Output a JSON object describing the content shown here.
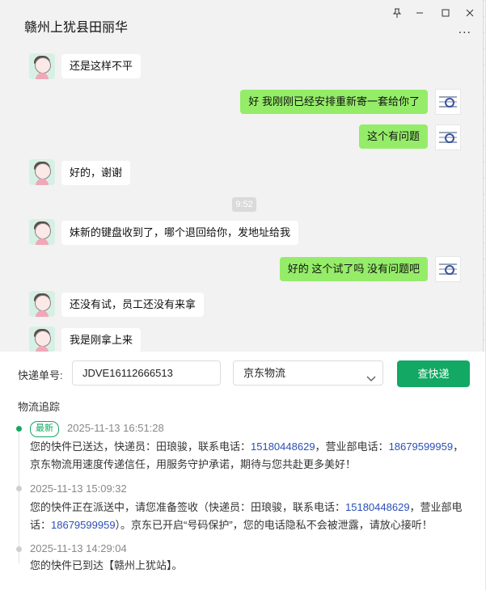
{
  "window": {
    "title": "赣州上犹县田丽华",
    "pin_icon": "pin-icon",
    "minimize_icon": "minimize-icon",
    "maximize_icon": "maximize-icon",
    "close_icon": "close-icon",
    "more_icon": "more-icon",
    "more_glyph": "..."
  },
  "messages": [
    {
      "side": "in",
      "text": "还是这样不平"
    },
    {
      "side": "out",
      "text": "好 我刚刚已经安排重新寄一套给你了"
    },
    {
      "side": "out",
      "text": "这个有问题"
    },
    {
      "side": "in",
      "text": "好的，谢谢"
    },
    {
      "side": "time",
      "text": "9:52"
    },
    {
      "side": "in",
      "text": "妹新的键盘收到了，哪个退回给你，发地址给我"
    },
    {
      "side": "out",
      "text": "好的  这个试了吗  没有问题吧"
    },
    {
      "side": "in",
      "text": "还没有试，员工还没有来拿"
    },
    {
      "side": "in",
      "text": "我是刚拿上来"
    }
  ],
  "query": {
    "label": "快递单号:",
    "tracking_number": "JDVE16112666513",
    "carrier": "京东物流",
    "submit_label": "查快递"
  },
  "tracking": {
    "title": "物流追踪",
    "latest_badge": "最新",
    "events": [
      {
        "time": "2025-11-13 16:51:28",
        "text_a": "您的快件已送达，快递员：田琅骏，联系电话：",
        "phone_a": "15180448629",
        "text_b": "，营业部电话：",
        "phone_b": "18679599959",
        "text_c": "，京东物流用速度传递信任，用服务守护承诺，期待与您共赴更多美好！"
      },
      {
        "time": "2025-11-13 15:09:32",
        "text_a": "您的快件正在派送中，请您准备签收（快递员：田琅骏，联系电话：",
        "phone_a": "15180448629",
        "text_b": "，营业部电话：",
        "phone_b": "18679599959",
        "text_c": "）。京东已开启“号码保护”，您的电话隐私不会被泄露，请放心接听！"
      },
      {
        "time": "2025-11-13 14:29:04",
        "text_a": "您的快件已到达【赣州上犹站】。"
      }
    ]
  },
  "colors": {
    "accent_green": "#13a863",
    "outgoing_bubble": "#95ec69",
    "phone_link": "#2c4fb5"
  }
}
